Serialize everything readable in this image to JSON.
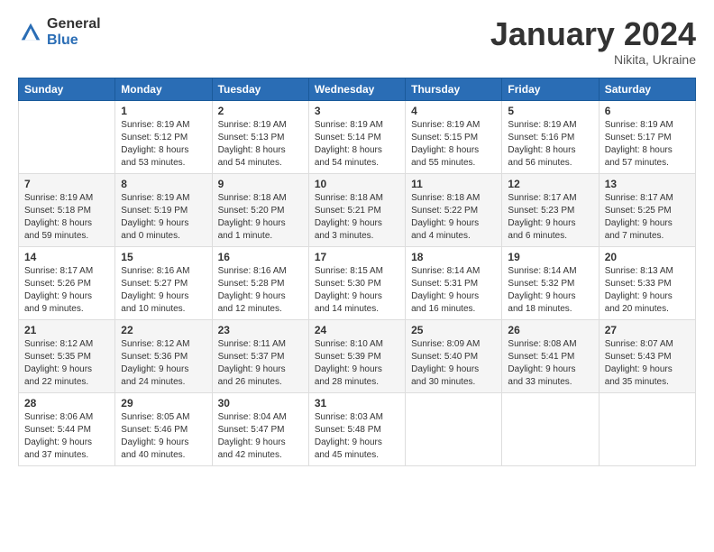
{
  "logo": {
    "general": "General",
    "blue": "Blue"
  },
  "header": {
    "month": "January 2024",
    "location": "Nikita, Ukraine"
  },
  "weekdays": [
    "Sunday",
    "Monday",
    "Tuesday",
    "Wednesday",
    "Thursday",
    "Friday",
    "Saturday"
  ],
  "weeks": [
    [
      {
        "day": "",
        "sunrise": "",
        "sunset": "",
        "daylight": ""
      },
      {
        "day": "1",
        "sunrise": "Sunrise: 8:19 AM",
        "sunset": "Sunset: 5:12 PM",
        "daylight": "Daylight: 8 hours and 53 minutes."
      },
      {
        "day": "2",
        "sunrise": "Sunrise: 8:19 AM",
        "sunset": "Sunset: 5:13 PM",
        "daylight": "Daylight: 8 hours and 54 minutes."
      },
      {
        "day": "3",
        "sunrise": "Sunrise: 8:19 AM",
        "sunset": "Sunset: 5:14 PM",
        "daylight": "Daylight: 8 hours and 54 minutes."
      },
      {
        "day": "4",
        "sunrise": "Sunrise: 8:19 AM",
        "sunset": "Sunset: 5:15 PM",
        "daylight": "Daylight: 8 hours and 55 minutes."
      },
      {
        "day": "5",
        "sunrise": "Sunrise: 8:19 AM",
        "sunset": "Sunset: 5:16 PM",
        "daylight": "Daylight: 8 hours and 56 minutes."
      },
      {
        "day": "6",
        "sunrise": "Sunrise: 8:19 AM",
        "sunset": "Sunset: 5:17 PM",
        "daylight": "Daylight: 8 hours and 57 minutes."
      }
    ],
    [
      {
        "day": "7",
        "sunrise": "Sunrise: 8:19 AM",
        "sunset": "Sunset: 5:18 PM",
        "daylight": "Daylight: 8 hours and 59 minutes."
      },
      {
        "day": "8",
        "sunrise": "Sunrise: 8:19 AM",
        "sunset": "Sunset: 5:19 PM",
        "daylight": "Daylight: 9 hours and 0 minutes."
      },
      {
        "day": "9",
        "sunrise": "Sunrise: 8:18 AM",
        "sunset": "Sunset: 5:20 PM",
        "daylight": "Daylight: 9 hours and 1 minute."
      },
      {
        "day": "10",
        "sunrise": "Sunrise: 8:18 AM",
        "sunset": "Sunset: 5:21 PM",
        "daylight": "Daylight: 9 hours and 3 minutes."
      },
      {
        "day": "11",
        "sunrise": "Sunrise: 8:18 AM",
        "sunset": "Sunset: 5:22 PM",
        "daylight": "Daylight: 9 hours and 4 minutes."
      },
      {
        "day": "12",
        "sunrise": "Sunrise: 8:17 AM",
        "sunset": "Sunset: 5:23 PM",
        "daylight": "Daylight: 9 hours and 6 minutes."
      },
      {
        "day": "13",
        "sunrise": "Sunrise: 8:17 AM",
        "sunset": "Sunset: 5:25 PM",
        "daylight": "Daylight: 9 hours and 7 minutes."
      }
    ],
    [
      {
        "day": "14",
        "sunrise": "Sunrise: 8:17 AM",
        "sunset": "Sunset: 5:26 PM",
        "daylight": "Daylight: 9 hours and 9 minutes."
      },
      {
        "day": "15",
        "sunrise": "Sunrise: 8:16 AM",
        "sunset": "Sunset: 5:27 PM",
        "daylight": "Daylight: 9 hours and 10 minutes."
      },
      {
        "day": "16",
        "sunrise": "Sunrise: 8:16 AM",
        "sunset": "Sunset: 5:28 PM",
        "daylight": "Daylight: 9 hours and 12 minutes."
      },
      {
        "day": "17",
        "sunrise": "Sunrise: 8:15 AM",
        "sunset": "Sunset: 5:30 PM",
        "daylight": "Daylight: 9 hours and 14 minutes."
      },
      {
        "day": "18",
        "sunrise": "Sunrise: 8:14 AM",
        "sunset": "Sunset: 5:31 PM",
        "daylight": "Daylight: 9 hours and 16 minutes."
      },
      {
        "day": "19",
        "sunrise": "Sunrise: 8:14 AM",
        "sunset": "Sunset: 5:32 PM",
        "daylight": "Daylight: 9 hours and 18 minutes."
      },
      {
        "day": "20",
        "sunrise": "Sunrise: 8:13 AM",
        "sunset": "Sunset: 5:33 PM",
        "daylight": "Daylight: 9 hours and 20 minutes."
      }
    ],
    [
      {
        "day": "21",
        "sunrise": "Sunrise: 8:12 AM",
        "sunset": "Sunset: 5:35 PM",
        "daylight": "Daylight: 9 hours and 22 minutes."
      },
      {
        "day": "22",
        "sunrise": "Sunrise: 8:12 AM",
        "sunset": "Sunset: 5:36 PM",
        "daylight": "Daylight: 9 hours and 24 minutes."
      },
      {
        "day": "23",
        "sunrise": "Sunrise: 8:11 AM",
        "sunset": "Sunset: 5:37 PM",
        "daylight": "Daylight: 9 hours and 26 minutes."
      },
      {
        "day": "24",
        "sunrise": "Sunrise: 8:10 AM",
        "sunset": "Sunset: 5:39 PM",
        "daylight": "Daylight: 9 hours and 28 minutes."
      },
      {
        "day": "25",
        "sunrise": "Sunrise: 8:09 AM",
        "sunset": "Sunset: 5:40 PM",
        "daylight": "Daylight: 9 hours and 30 minutes."
      },
      {
        "day": "26",
        "sunrise": "Sunrise: 8:08 AM",
        "sunset": "Sunset: 5:41 PM",
        "daylight": "Daylight: 9 hours and 33 minutes."
      },
      {
        "day": "27",
        "sunrise": "Sunrise: 8:07 AM",
        "sunset": "Sunset: 5:43 PM",
        "daylight": "Daylight: 9 hours and 35 minutes."
      }
    ],
    [
      {
        "day": "28",
        "sunrise": "Sunrise: 8:06 AM",
        "sunset": "Sunset: 5:44 PM",
        "daylight": "Daylight: 9 hours and 37 minutes."
      },
      {
        "day": "29",
        "sunrise": "Sunrise: 8:05 AM",
        "sunset": "Sunset: 5:46 PM",
        "daylight": "Daylight: 9 hours and 40 minutes."
      },
      {
        "day": "30",
        "sunrise": "Sunrise: 8:04 AM",
        "sunset": "Sunset: 5:47 PM",
        "daylight": "Daylight: 9 hours and 42 minutes."
      },
      {
        "day": "31",
        "sunrise": "Sunrise: 8:03 AM",
        "sunset": "Sunset: 5:48 PM",
        "daylight": "Daylight: 9 hours and 45 minutes."
      },
      {
        "day": "",
        "sunrise": "",
        "sunset": "",
        "daylight": ""
      },
      {
        "day": "",
        "sunrise": "",
        "sunset": "",
        "daylight": ""
      },
      {
        "day": "",
        "sunrise": "",
        "sunset": "",
        "daylight": ""
      }
    ]
  ]
}
